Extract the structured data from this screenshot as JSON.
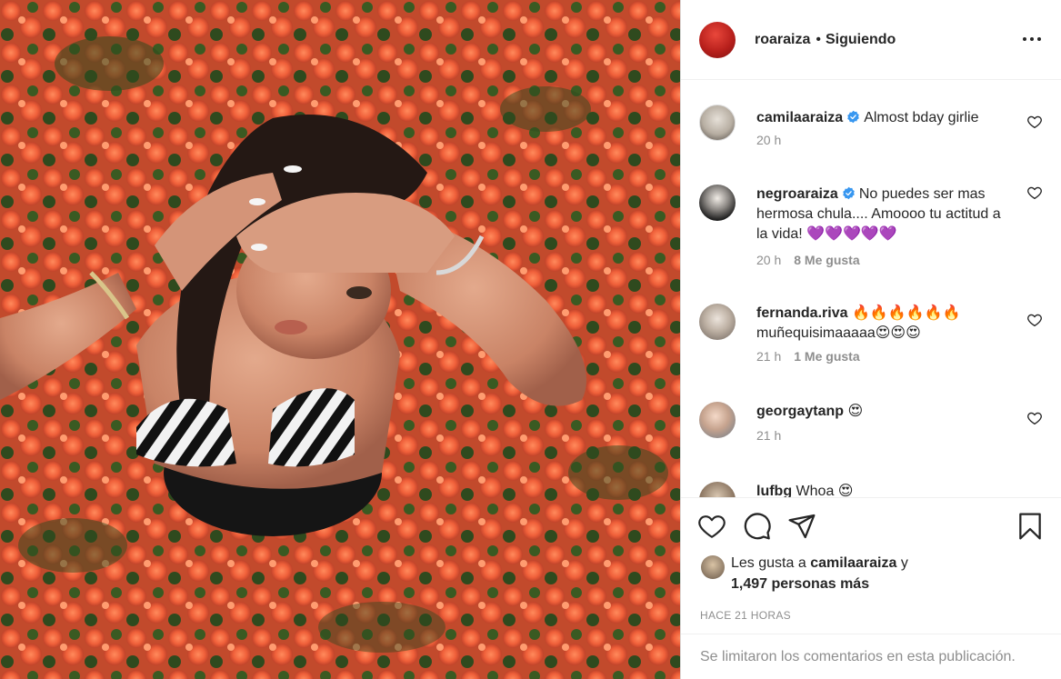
{
  "header": {
    "username": "roaraiza",
    "dot": "•",
    "follow_status": "Siguiendo"
  },
  "comments": [
    {
      "username": "camilaaraiza",
      "verified": true,
      "text": "Almost bday girlie",
      "time": "20 h",
      "likes": ""
    },
    {
      "username": "negroaraiza",
      "verified": true,
      "text": "No puedes ser mas hermosa chula.... Amoooo tu actitud a la vida! 💜💜💜💜💜",
      "time": "20 h",
      "likes": "8 Me gusta"
    },
    {
      "username": "fernanda.riva",
      "verified": false,
      "text": "🔥🔥🔥🔥🔥🔥 muñequisimaaaaa😍😍😍",
      "time": "21 h",
      "likes": "1 Me gusta"
    },
    {
      "username": "georgaytanp",
      "verified": false,
      "text": "😍",
      "time": "21 h",
      "likes": ""
    },
    {
      "username": "lufbg",
      "verified": false,
      "text": "Whoa 😍",
      "time": "",
      "likes": ""
    }
  ],
  "likes": {
    "prefix": "Les gusta a",
    "user": "camilaaraiza",
    "suffix": "y",
    "count_text": "1,497 personas más"
  },
  "timestamp": "HACE 21 HORAS",
  "comments_limited": "Se limitaron los comentarios en esta publicación.",
  "icons": {
    "like": "heart-icon",
    "comment": "comment-bubble-icon",
    "share": "paper-plane-icon",
    "save": "bookmark-icon",
    "more": "ellipsis-icon",
    "verified": "verified-badge-icon"
  },
  "colors": {
    "verified_blue": "#3897f0",
    "text": "#262626",
    "muted": "#8e8e8e",
    "border": "#dbdbdb"
  }
}
